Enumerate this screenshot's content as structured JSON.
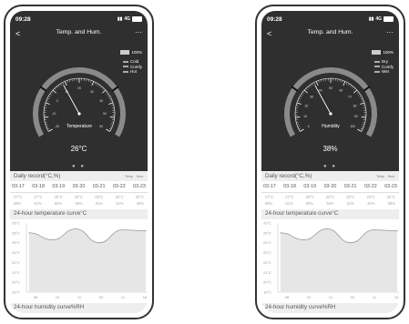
{
  "phones": [
    {
      "status": {
        "time": "09:28",
        "network": "4G"
      },
      "nav": {
        "back": "<",
        "title": "Temp. and Hum.",
        "more": "···"
      },
      "battery": "100%",
      "legend": [
        "Cold",
        "Comfy",
        "Hot"
      ],
      "gauge": {
        "label": "Temperature",
        "value": "26°C",
        "needle_fraction": 0.38,
        "ticks": [
          "-20",
          "-10",
          "0",
          "10",
          "20",
          "30",
          "40",
          "50",
          "60"
        ]
      },
      "pager": "● ●",
      "daily": {
        "title": "Daily record(°C,%)",
        "legend": [
          "Temp.",
          "Hum."
        ],
        "dates": [
          "03-17",
          "03-18",
          "03-19",
          "03-20",
          "03-21",
          "03-22",
          "03-23"
        ],
        "temps": [
          "27°C",
          "27°C",
          "28°C",
          "29°C",
          "28°C",
          "26°C",
          "26°C"
        ],
        "hums": [
          "58%",
          "61%",
          "60%",
          "58%",
          "51%",
          "40%",
          "38%"
        ]
      },
      "curve_title": "24-hour temperature curve°C",
      "bottom_title": "24-hour humidity curve%RH",
      "chart_data": {
        "type": "line",
        "title": "24-hour temperature curve°C",
        "y_ticks": [
          "26°C",
          "26°C",
          "25°C",
          "24°C",
          "22°C",
          "21°C",
          "20°C",
          "19°C"
        ],
        "x": [
          "08",
          "10",
          "11",
          "02",
          "11",
          "16"
        ],
        "values": [
          25.0,
          24.3,
          25.4,
          24.0,
          25.3,
          25.2
        ]
      }
    },
    {
      "status": {
        "time": "09:28",
        "network": "4G"
      },
      "nav": {
        "back": "<",
        "title": "Temp. and Hum.",
        "more": "···"
      },
      "battery": "100%",
      "legend": [
        "Dry",
        "Comfy",
        "Wet"
      ],
      "gauge": {
        "label": "Humidity",
        "value": "38%",
        "needle_fraction": 0.38,
        "ticks": [
          "0",
          "10",
          "20",
          "30",
          "40",
          "50",
          "60",
          "70",
          "80",
          "90",
          "100"
        ]
      },
      "pager": "● ●",
      "daily": {
        "title": "Daily record(°C,%)",
        "legend": [
          "Temp.",
          "Hum."
        ],
        "dates": [
          "03-17",
          "03-18",
          "03-19",
          "03-20",
          "03-21",
          "03-22",
          "03-23"
        ],
        "temps": [
          "27°C",
          "27°C",
          "28°C",
          "29°C",
          "28°C",
          "26°C",
          "26°C"
        ],
        "hums": [
          "58%",
          "61%",
          "60%",
          "58%",
          "51%",
          "40%",
          "38%"
        ]
      },
      "curve_title": "24-hour temperature curve°C",
      "bottom_title": "24-hour humidity curve%RH",
      "chart_data": {
        "type": "line",
        "title": "24-hour temperature curve°C",
        "y_ticks": [
          "26°C",
          "25°C",
          "24°C",
          "23°C",
          "22°C",
          "21°C",
          "20°C",
          "19°C"
        ],
        "x": [
          "08",
          "10",
          "11",
          "02",
          "11",
          "16"
        ],
        "values": [
          25.0,
          24.3,
          25.4,
          24.0,
          25.3,
          25.2
        ]
      }
    }
  ]
}
